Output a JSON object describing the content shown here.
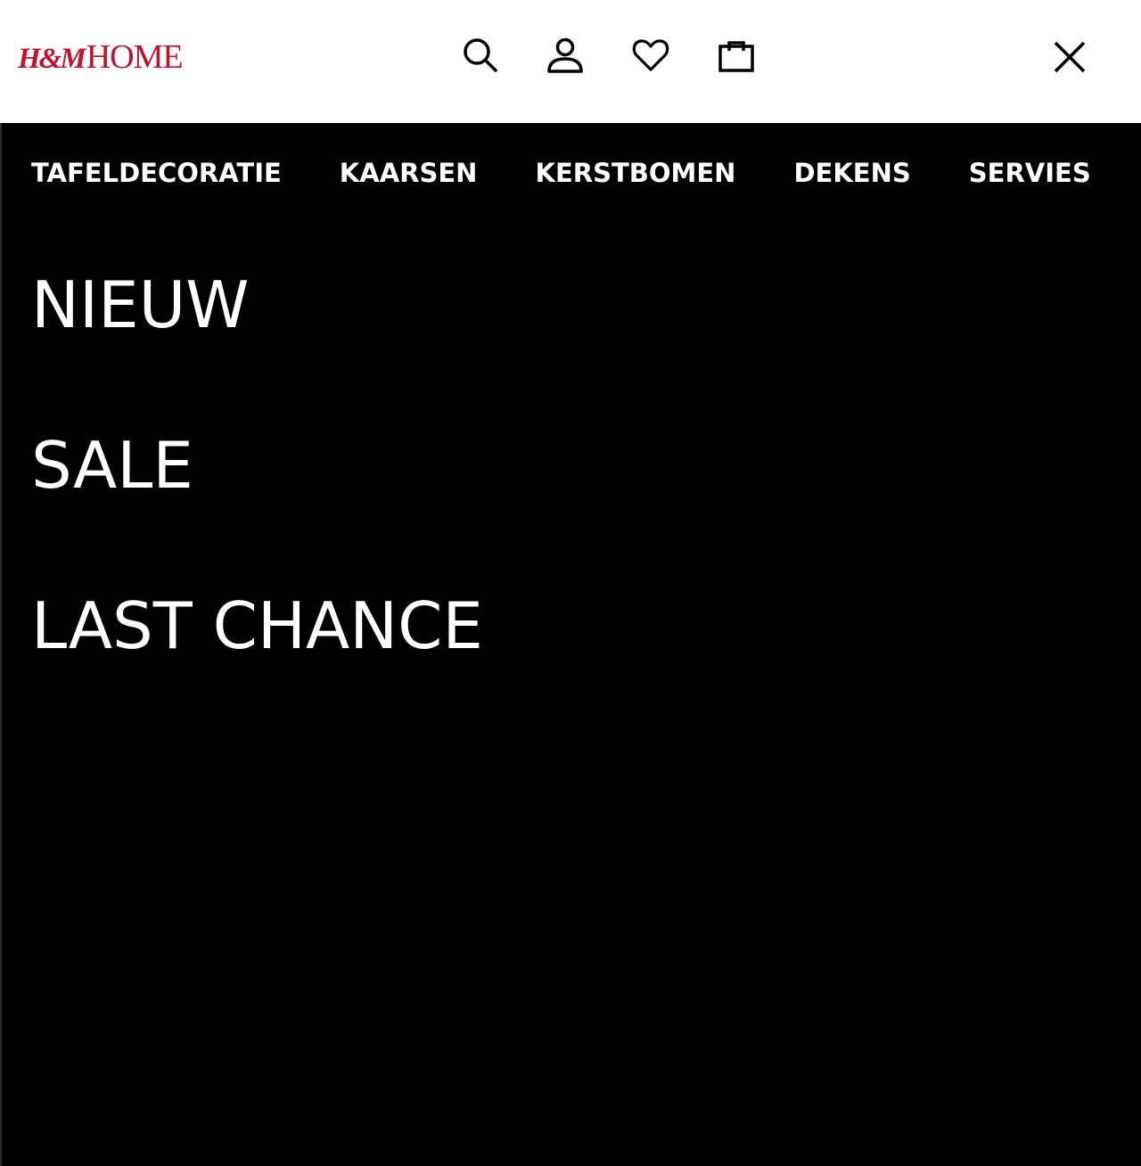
{
  "header": {
    "logo_hm": "H&M",
    "logo_home": "HOME",
    "icons": [
      "search-icon",
      "account-icon",
      "heart-icon",
      "bag-icon",
      "close-icon"
    ]
  },
  "categories": [
    "TAFELDECORATIE",
    "KAARSEN",
    "KERSTBOMEN",
    "DEKENS",
    "SERVIES"
  ],
  "menu": [
    "NIEUW",
    "SALE",
    "LAST CHANCE"
  ],
  "colors": {
    "brand": "#c8102e",
    "background": "#000000",
    "header": "#ffffff",
    "text": "#ffffff"
  }
}
